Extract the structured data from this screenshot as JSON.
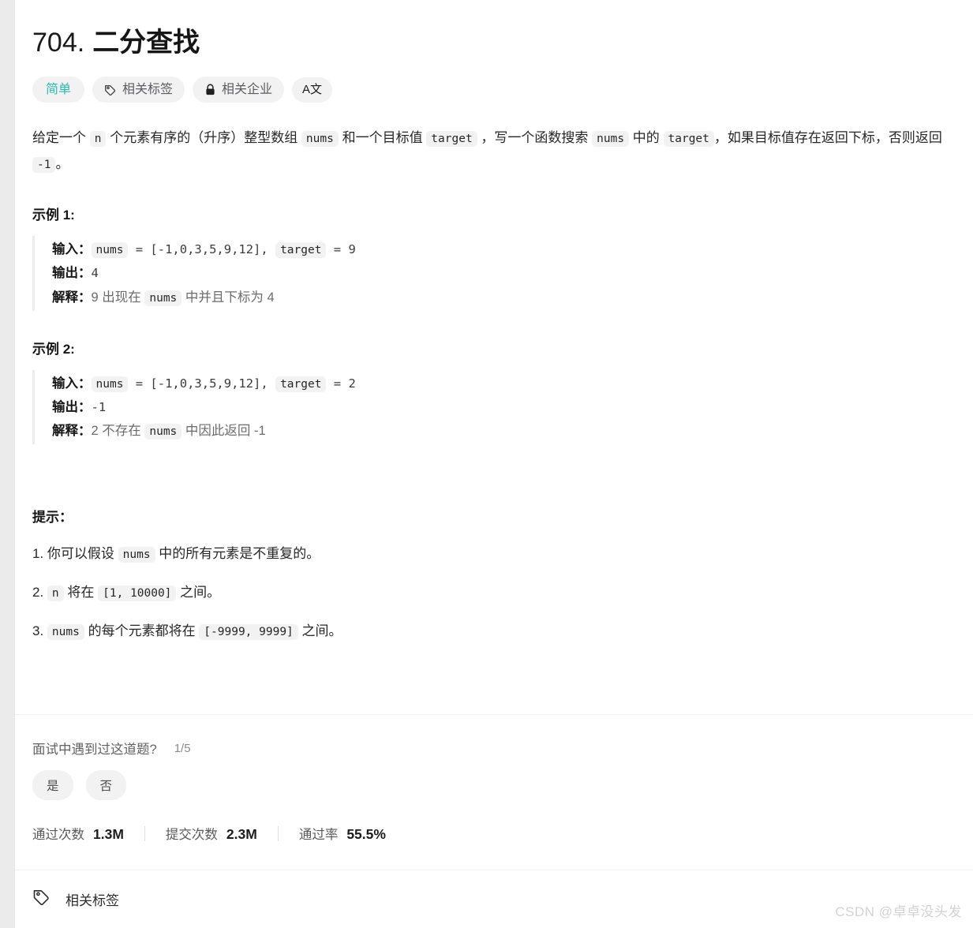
{
  "problem": {
    "number": "704.",
    "title": "二分查找",
    "difficulty": "简单",
    "badges": [
      {
        "label": "相关标签",
        "icon": "tag-icon"
      },
      {
        "label": "相关企业",
        "icon": "lock-icon"
      },
      {
        "label": "A文",
        "icon": "translate-icon"
      }
    ]
  },
  "description": {
    "part1": "给定一个 ",
    "code_n": "n",
    "part2": " 个元素有序的（升序）整型数组 ",
    "code_nums1": "nums",
    "part3": " 和一个目标值 ",
    "code_target1": "target",
    "part4": " ，写一个函数搜索 ",
    "code_nums2": "nums",
    "part5": " 中的 ",
    "code_target2": "target",
    "part6": "，如果目标值存在返回下标，否则返回 ",
    "code_minus1": "-1",
    "part7": "。"
  },
  "examples": [
    {
      "heading": "示例 1:",
      "input_label": "输入：",
      "input_code_nums": "nums",
      "input_mid": " = [-1,0,3,5,9,12], ",
      "input_code_target": "target",
      "input_tail": " = 9",
      "output_label": "输出：",
      "output_value": "4",
      "explain_label": "解释：",
      "explain_pre": "9 出现在 ",
      "explain_code": "nums",
      "explain_post": " 中并且下标为 4"
    },
    {
      "heading": "示例 2:",
      "input_label": "输入：",
      "input_code_nums": "nums",
      "input_mid": " = [-1,0,3,5,9,12], ",
      "input_code_target": "target",
      "input_tail": " = 2",
      "output_label": "输出：",
      "output_value": "-1",
      "explain_label": "解释：",
      "explain_pre": "2 不存在 ",
      "explain_code": "nums",
      "explain_post": " 中因此返回 -1"
    }
  ],
  "hints": {
    "heading": "提示：",
    "items": [
      {
        "num": "1.",
        "pre": " 你可以假设 ",
        "code": "nums",
        "post": " 中的所有元素是不重复的。"
      },
      {
        "num": "2.",
        "pre": " ",
        "code": "n",
        "mid": " 将在 ",
        "code2": "[1, 10000]",
        "post": " 之间。"
      },
      {
        "num": "3.",
        "pre": " ",
        "code": "nums",
        "mid": " 的每个元素都将在 ",
        "code2": "[-9999, 9999]",
        "post": " 之间。"
      }
    ]
  },
  "poll": {
    "question": "面试中遇到过这道题?",
    "count": "1/5",
    "yes": "是",
    "no": "否"
  },
  "stats": [
    {
      "label": "通过次数",
      "value": "1.3M"
    },
    {
      "label": "提交次数",
      "value": "2.3M"
    },
    {
      "label": "通过率",
      "value": "55.5%"
    }
  ],
  "tags_footer": {
    "label": "相关标签"
  },
  "watermark": "CSDN @卓卓没头发",
  "colors": {
    "easy": "#2cbab0",
    "chip_bg": "#f2f2f2",
    "pill_bg": "#f2f2f3",
    "divider": "#f0f0f0"
  }
}
